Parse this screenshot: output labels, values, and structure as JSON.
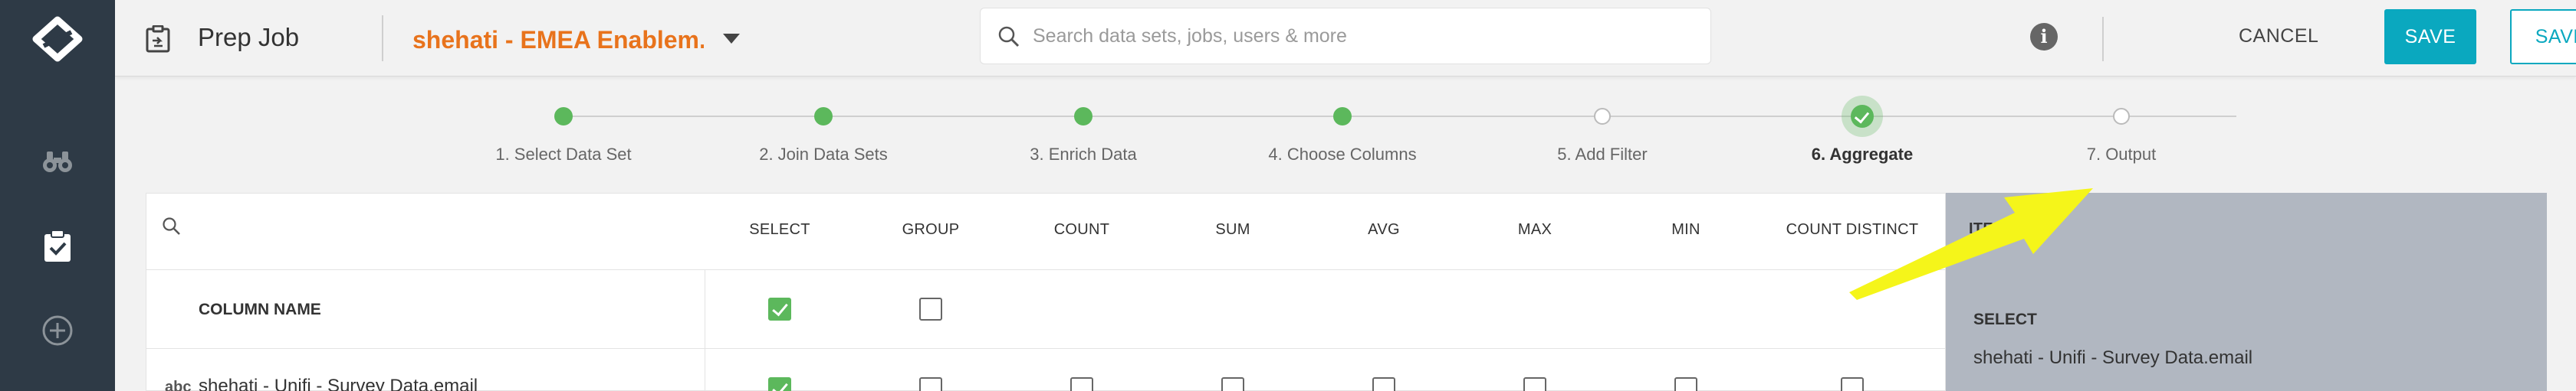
{
  "header": {
    "title": "Prep Job",
    "dataset_name": "shehati - EMEA Enablem...",
    "search": {
      "placeholder": "Search data sets, jobs, users & more",
      "value": ""
    },
    "cancel_label": "CANCEL",
    "save_label": "SAVE",
    "save_run_label": "SAVE & RUN"
  },
  "rail": {
    "items": [
      {
        "icon": "binoculars-icon",
        "active": false
      },
      {
        "icon": "clipboard-check-icon",
        "active": true
      },
      {
        "icon": "add-circle-icon",
        "active": false
      }
    ]
  },
  "stepper": {
    "steps": [
      {
        "label": "1. Select Data Set",
        "state": "done"
      },
      {
        "label": "2. Join Data Sets",
        "state": "done"
      },
      {
        "label": "3. Enrich Data",
        "state": "done"
      },
      {
        "label": "4. Choose Columns",
        "state": "done"
      },
      {
        "label": "5. Add Filter",
        "state": "pending"
      },
      {
        "label": "6. Aggregate",
        "state": "current"
      },
      {
        "label": "7. Output",
        "state": "pending"
      }
    ]
  },
  "table": {
    "columns": [
      "SELECT",
      "GROUP",
      "COUNT",
      "SUM",
      "AVG",
      "MAX",
      "MIN",
      "COUNT DISTINCT"
    ],
    "column_name_header": "COLUMN NAME",
    "header_checks": {
      "select": true,
      "group": false
    },
    "rows": [
      {
        "type": "abc",
        "name": "shehati - Unifi - Survey Data.email",
        "select": true,
        "group": false,
        "count": false,
        "sum": false,
        "avg": false,
        "max": false,
        "min": false,
        "count_distinct": false
      }
    ]
  },
  "side_panel": {
    "item_list_label": "ITEM LIST",
    "select_heading": "SELECT",
    "select_value": "shehati - Unifi - Survey Data.email"
  },
  "colors": {
    "rail": "#2e3a46",
    "accent": "#0aa8bf",
    "dataset_name": "#e8731c",
    "step_done": "#5cb85c",
    "annotation_arrow": "#f5f51a"
  }
}
